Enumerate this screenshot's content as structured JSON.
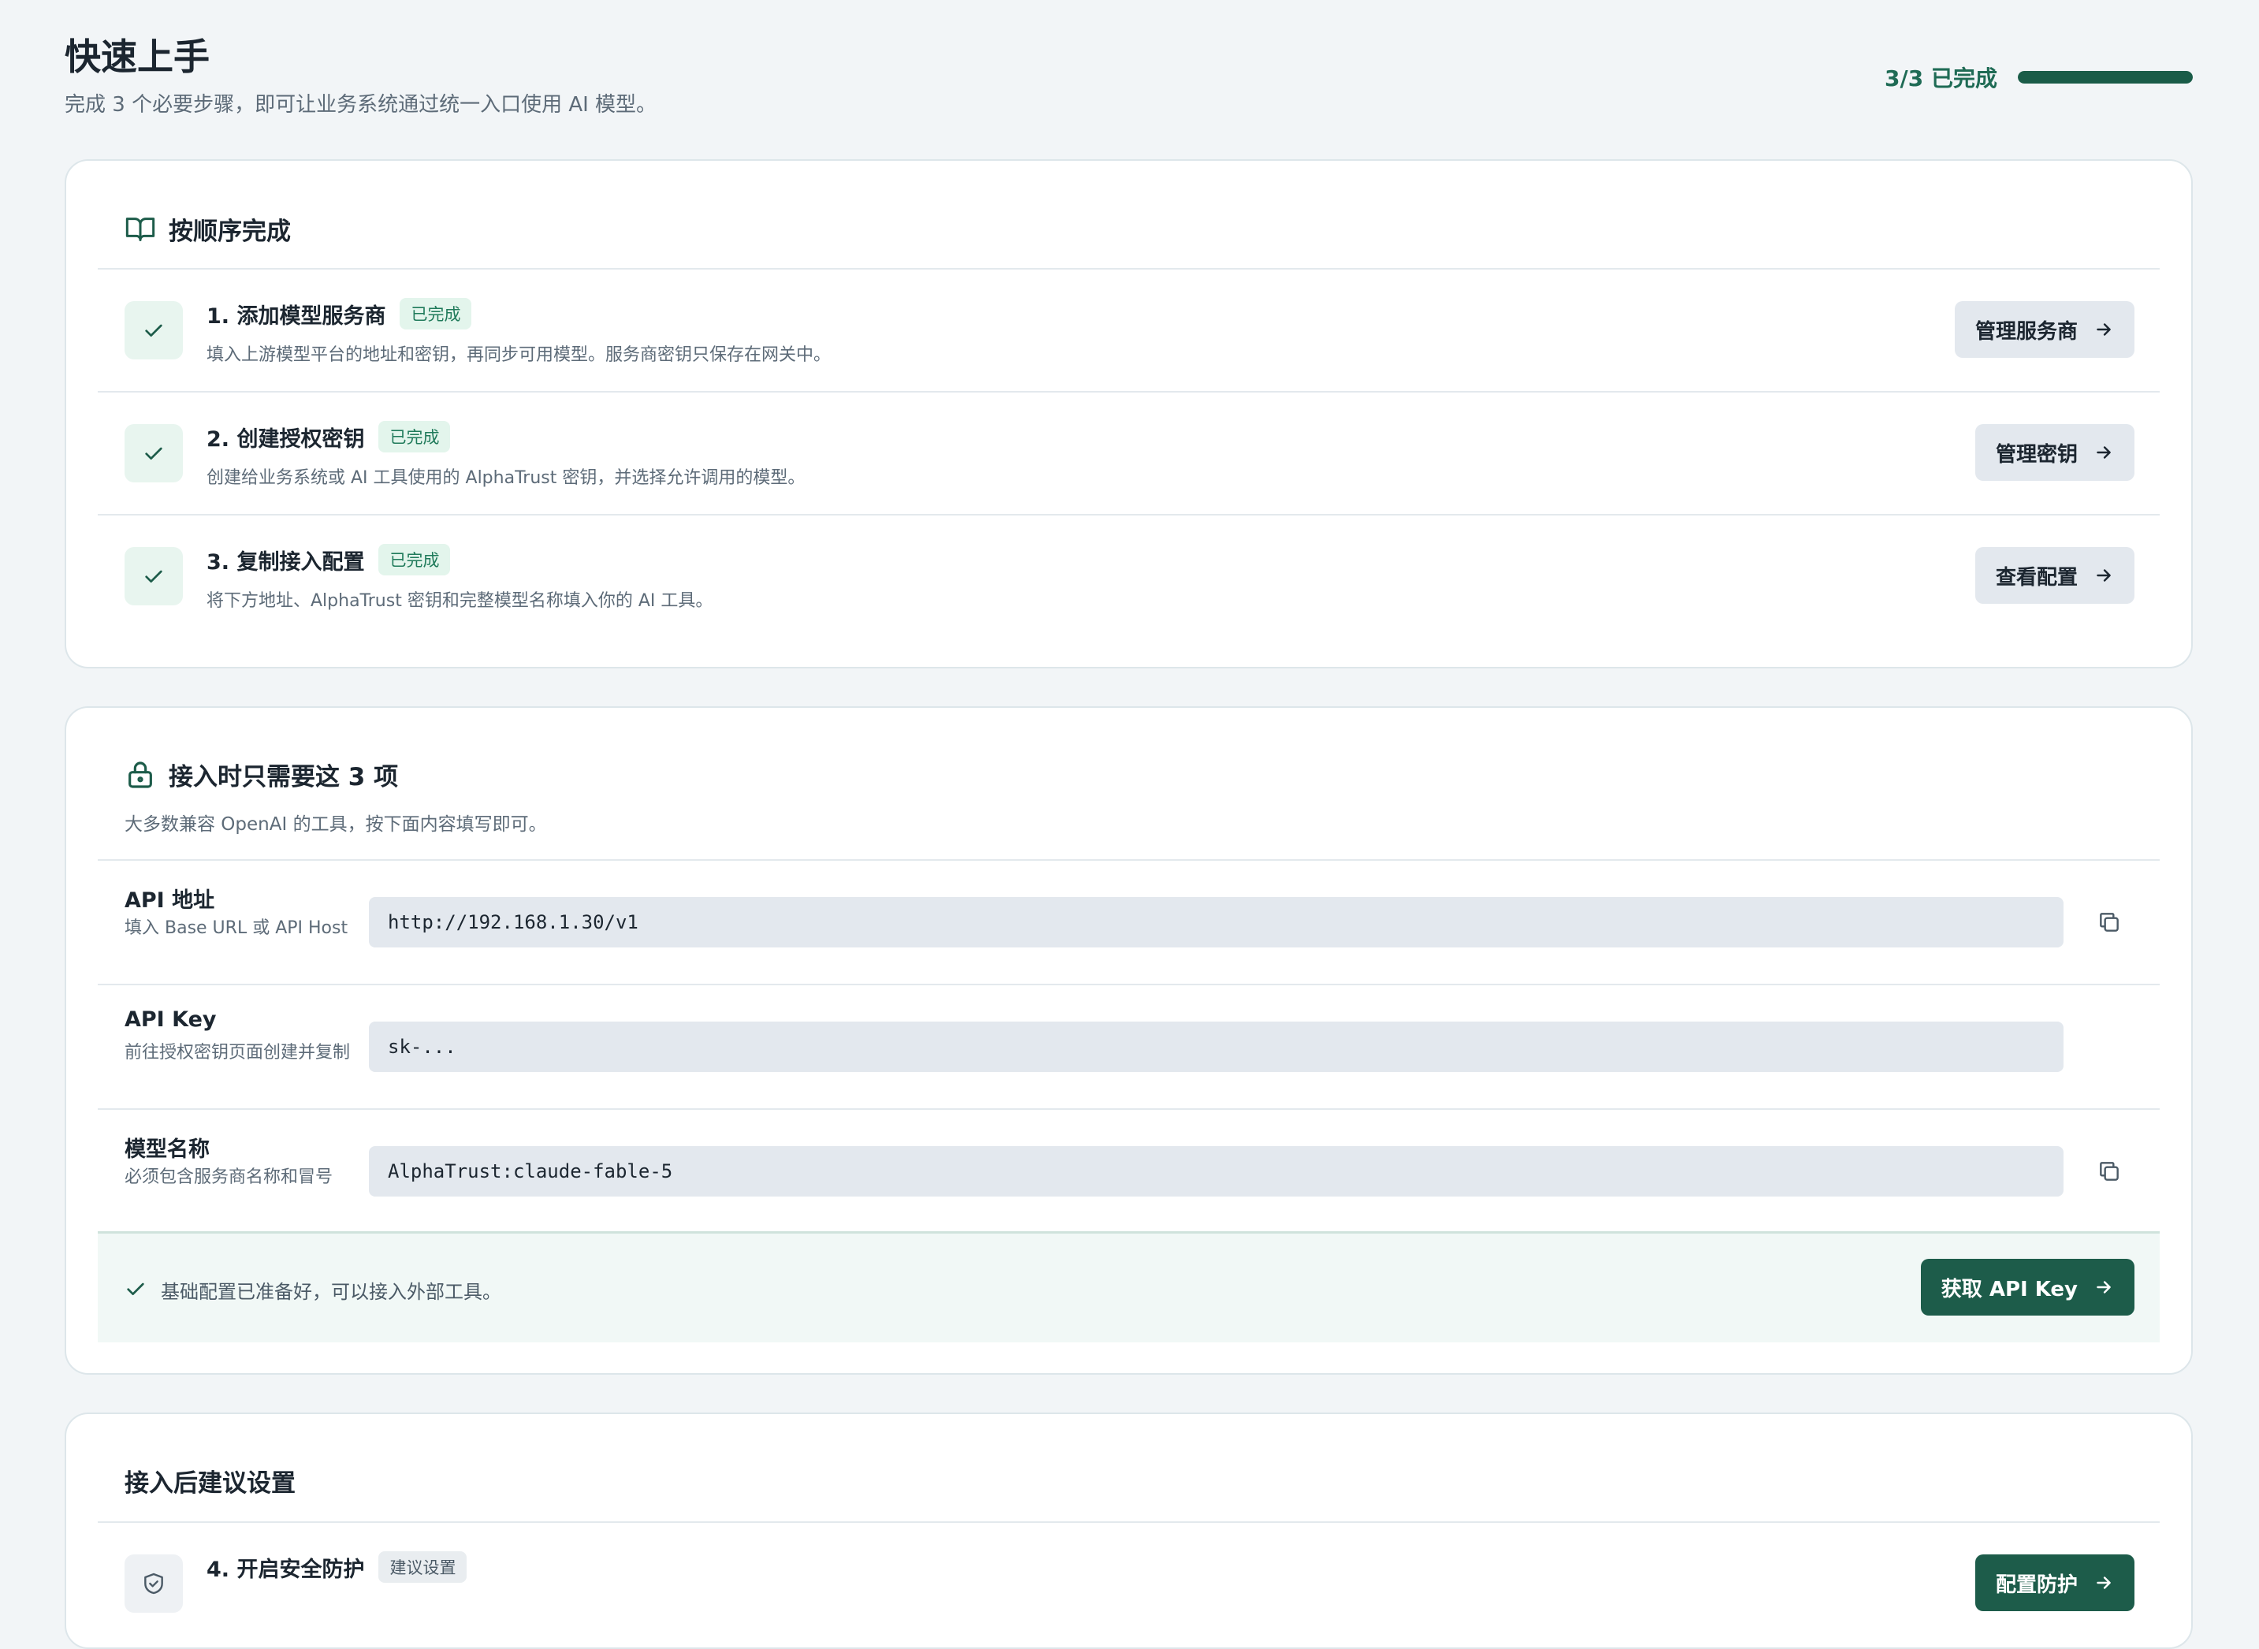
{
  "header": {
    "title": "快速上手",
    "subtitle": "完成 3 个必要步骤，即可让业务系统通过统一入口使用 AI 模型。",
    "progress_text": "3/3 已完成",
    "progress_fraction": 1.0
  },
  "steps_card": {
    "title": "按顺序完成",
    "icon": "book-open-icon",
    "steps": [
      {
        "title": "1. 添加模型服务商",
        "badge": "已完成",
        "desc": "填入上游模型平台的地址和密钥，再同步可用模型。服务商密钥只保存在网关中。",
        "button": "管理服务商"
      },
      {
        "title": "2. 创建授权密钥",
        "badge": "已完成",
        "desc": "创建给业务系统或 AI 工具使用的 AlphaTrust 密钥，并选择允许调用的模型。",
        "button": "管理密钥"
      },
      {
        "title": "3. 复制接入配置",
        "badge": "已完成",
        "desc": "将下方地址、AlphaTrust 密钥和完整模型名称填入你的 AI 工具。",
        "button": "查看配置"
      }
    ]
  },
  "config_card": {
    "title": "接入时只需要这 3 项",
    "icon": "lock-icon",
    "desc": "大多数兼容 OpenAI 的工具，按下面内容填写即可。",
    "fields": [
      {
        "label": "API 地址",
        "hint": "填入 Base URL 或 API Host",
        "value": "http://192.168.1.30/v1",
        "copyable": true
      },
      {
        "label": "API Key",
        "hint": "前往授权密钥页面创建并复制",
        "value": "sk-...",
        "copyable": false
      },
      {
        "label": "模型名称",
        "hint": "必须包含服务商名称和冒号",
        "value": "AlphaTrust:claude-fable-5",
        "copyable": true
      }
    ],
    "ready_text": "基础配置已准备好，可以接入外部工具。",
    "ready_button": "获取 API Key"
  },
  "advice_card": {
    "title": "接入后建议设置",
    "steps": [
      {
        "title": "4. 开启安全防护",
        "badge": "建议设置",
        "button": "配置防护"
      }
    ]
  },
  "colors": {
    "accent": "#1d5c4a",
    "accent_text": "#1f6b55",
    "badge_bg": "#e3f5ec",
    "page_bg": "#f2f5f7"
  }
}
